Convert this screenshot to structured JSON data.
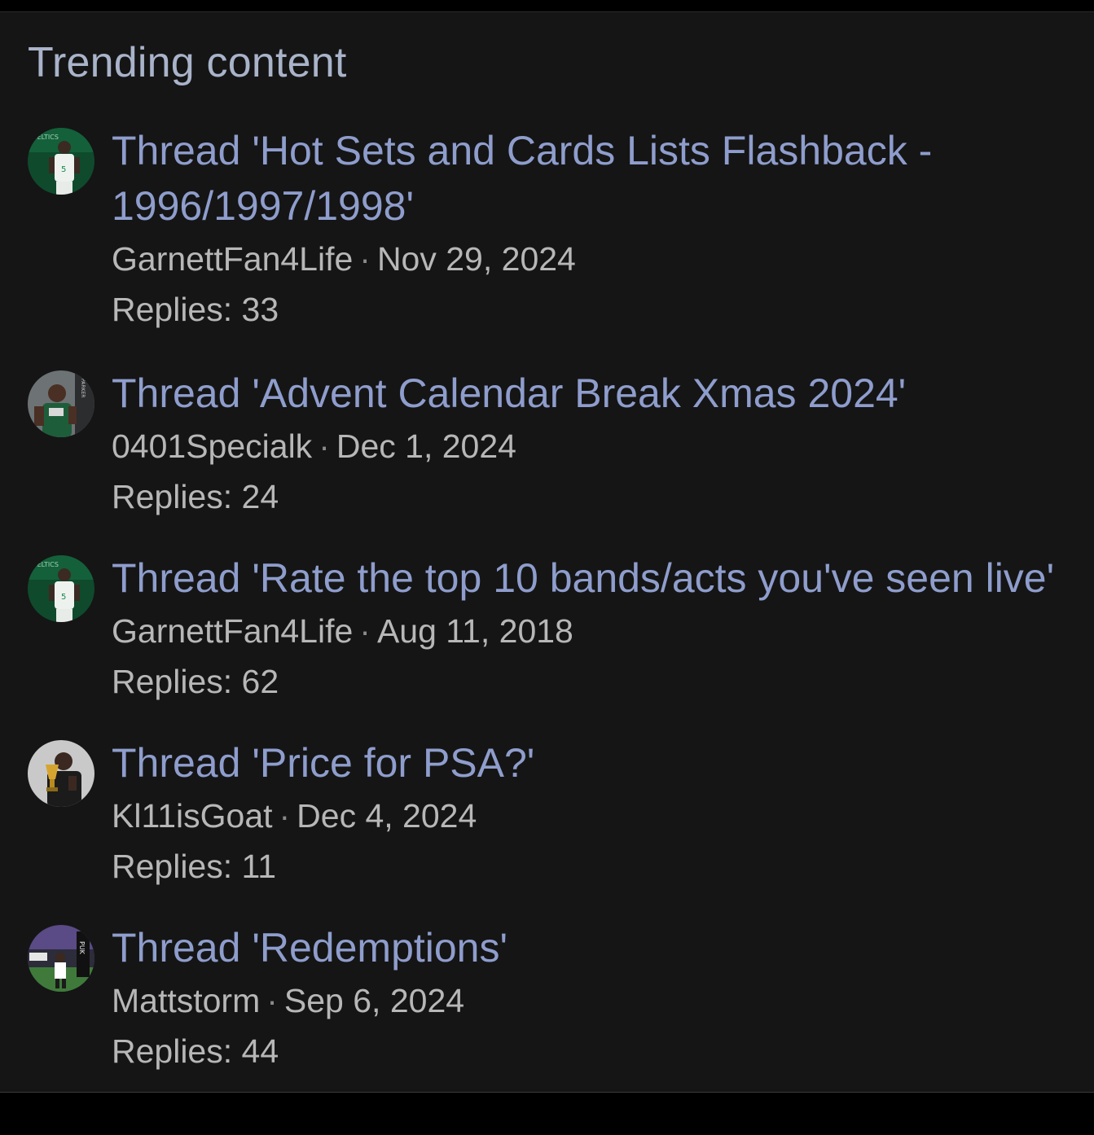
{
  "block": {
    "title": "Trending content"
  },
  "items": [
    {
      "prefix": "Thread",
      "title": "'Hot Sets and Cards Lists Flashback - 1996/1997/1998'",
      "author": "GarnettFan4Life",
      "date": "Nov 29, 2024",
      "replies": "Replies: 33",
      "avatar": "green-jersey-player-avatar"
    },
    {
      "prefix": "Thread",
      "title": "'Advent Calendar Break Xmas 2024'",
      "author": "0401Specialk",
      "date": "Dec 1, 2024",
      "replies": "Replies: 24",
      "avatar": "player-portrait-avatar"
    },
    {
      "prefix": "Thread",
      "title": "'Rate the top 10 bands/acts you've seen live'",
      "author": "GarnettFan4Life",
      "date": "Aug 11, 2018",
      "replies": "Replies: 62",
      "avatar": "green-jersey-player-avatar"
    },
    {
      "prefix": "Thread",
      "title": "'Price for PSA?'",
      "author": "Kl11isGoat",
      "date": "Dec 4, 2024",
      "replies": "Replies: 11",
      "avatar": "trophy-player-avatar"
    },
    {
      "prefix": "Thread",
      "title": "'Redemptions'",
      "author": "Mattstorm",
      "date": "Sep 6, 2024",
      "replies": "Replies: 44",
      "avatar": "stadium-player-avatar"
    }
  ],
  "colors": {
    "link": "#8e9dcc",
    "title": "#a9b3c9",
    "meta": "#b7b7b7",
    "background": "#151515"
  }
}
